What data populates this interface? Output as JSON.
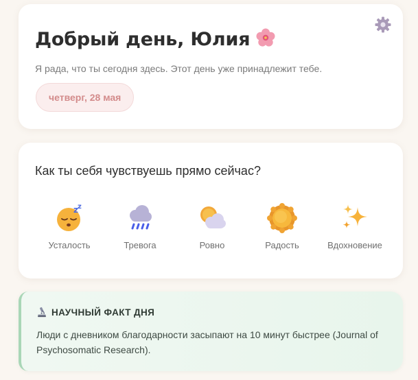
{
  "greeting": {
    "title": "Добрый день, Юлия",
    "title_icon": "cherry-blossom-icon",
    "subtitle": "Я рада, что ты сегодня здесь. Этот день уже принадлежит тебе.",
    "date": "четверг, 28 мая",
    "settings_icon": "gear-icon"
  },
  "mood": {
    "question": "Как ты себя чувствуешь прямо сейчас?",
    "options": [
      {
        "label": "Усталость",
        "icon": "sleepy-face-icon"
      },
      {
        "label": "Тревога",
        "icon": "rain-cloud-icon"
      },
      {
        "label": "Ровно",
        "icon": "sun-behind-cloud-icon"
      },
      {
        "label": "Радость",
        "icon": "sun-icon"
      },
      {
        "label": "Вдохновение",
        "icon": "sparkles-icon"
      }
    ]
  },
  "fact": {
    "icon": "microscope-icon",
    "heading": "НАУЧНЫЙ ФАКТ ДНЯ",
    "text": "Люди с дневником благодарности засыпают на 10 минут быстрее (Journal of Psychosomatic Research)."
  },
  "colors": {
    "background": "#faf6f1",
    "date_pill_text": "#d38b8b",
    "date_pill_bg": "#fbeeee",
    "fact_bg": "#e8f5ec",
    "fact_border": "#a9d6b7"
  }
}
